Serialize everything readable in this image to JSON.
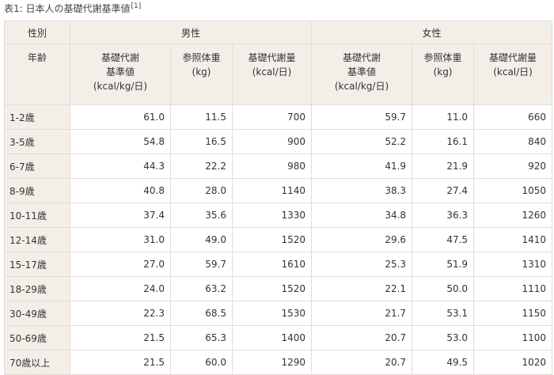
{
  "caption": {
    "text": "表1: 日本人の基礎代謝基準値",
    "ref": "[1]"
  },
  "table": {
    "corner_top": "性別",
    "corner_bottom": "年齢",
    "groups": [
      "男性",
      "女性"
    ],
    "subheaders": [
      [
        "基礎代謝",
        "基準値",
        "(kcal/kg/日)"
      ],
      [
        "参照体重",
        "(kg)"
      ],
      [
        "基礎代謝量",
        "(kcal/日)"
      ],
      [
        "基礎代謝",
        "基準値",
        "(kcal/kg/日)"
      ],
      [
        "参照体重",
        "(kg)"
      ],
      [
        "基礎代謝量",
        "(kcal/日)"
      ]
    ],
    "rows": [
      {
        "age": "1-2歳",
        "values": [
          "61.0",
          "11.5",
          "700",
          "59.7",
          "11.0",
          "660"
        ]
      },
      {
        "age": "3-5歳",
        "values": [
          "54.8",
          "16.5",
          "900",
          "52.2",
          "16.1",
          "840"
        ]
      },
      {
        "age": "6-7歳",
        "values": [
          "44.3",
          "22.2",
          "980",
          "41.9",
          "21.9",
          "920"
        ]
      },
      {
        "age": "8-9歳",
        "values": [
          "40.8",
          "28.0",
          "1140",
          "38.3",
          "27.4",
          "1050"
        ]
      },
      {
        "age": "10-11歳",
        "values": [
          "37.4",
          "35.6",
          "1330",
          "34.8",
          "36.3",
          "1260"
        ]
      },
      {
        "age": "12-14歳",
        "values": [
          "31.0",
          "49.0",
          "1520",
          "29.6",
          "47.5",
          "1410"
        ]
      },
      {
        "age": "15-17歳",
        "values": [
          "27.0",
          "59.7",
          "1610",
          "25.3",
          "51.9",
          "1310"
        ]
      },
      {
        "age": "18-29歳",
        "values": [
          "24.0",
          "63.2",
          "1520",
          "22.1",
          "50.0",
          "1110"
        ]
      },
      {
        "age": "30-49歳",
        "values": [
          "22.3",
          "68.5",
          "1530",
          "21.7",
          "53.1",
          "1150"
        ]
      },
      {
        "age": "50-69歳",
        "values": [
          "21.5",
          "65.3",
          "1400",
          "20.7",
          "53.0",
          "1100"
        ]
      },
      {
        "age": "70歳以上",
        "values": [
          "21.5",
          "60.0",
          "1290",
          "20.7",
          "49.5",
          "1020"
        ]
      }
    ]
  }
}
